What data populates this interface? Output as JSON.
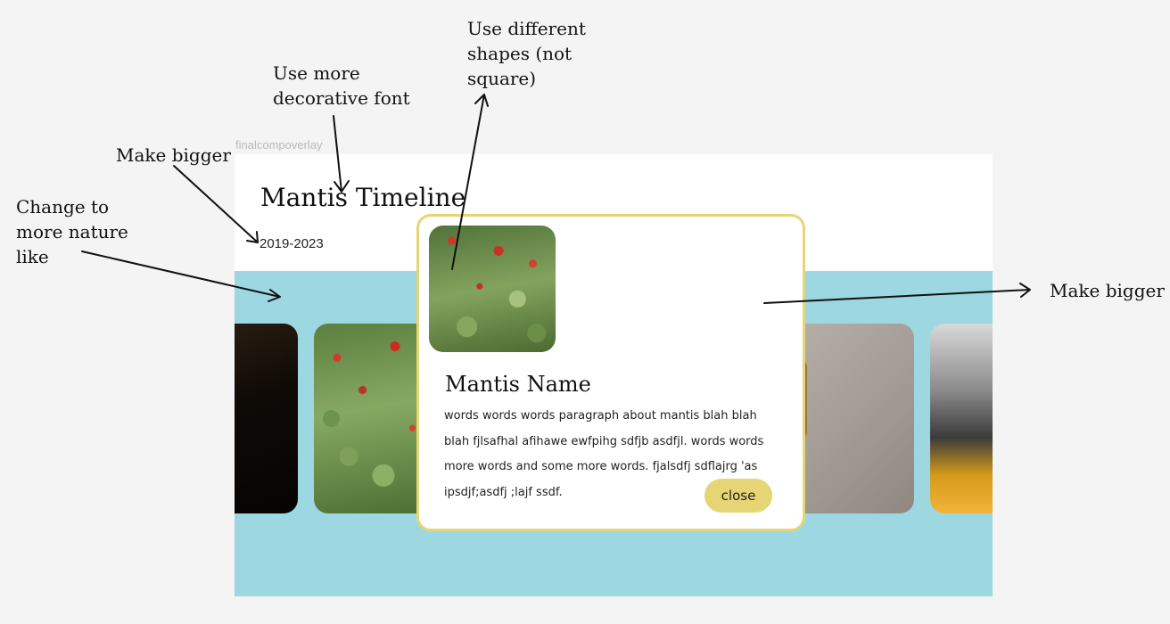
{
  "frame": {
    "label": "finalcompoverlay"
  },
  "page": {
    "title": "Mantis Timeline",
    "subtitle": "2019-2023"
  },
  "modal": {
    "title": "Mantis Name",
    "body": "words words words paragraph about mantis blah blah blah fjlsafhal afihawe ewfpihg sdfjb asdfjl. words words more words and some more words. fjalsdfj sdflajrg 'as ipsdjf;asdfj ;lajf ssdf.",
    "close_label": "close"
  },
  "annotations": {
    "font": "Use more\ndecorative font",
    "shapes": "Use different\nshapes (not\nsquare)",
    "bigger_title": "Make bigger",
    "nature": "Change to\nmore nature\nlike",
    "bigger_modal": "Make bigger"
  },
  "colors": {
    "band": "#9dd7e1",
    "accent": "#e6d574",
    "background": "#f4f4f4"
  }
}
